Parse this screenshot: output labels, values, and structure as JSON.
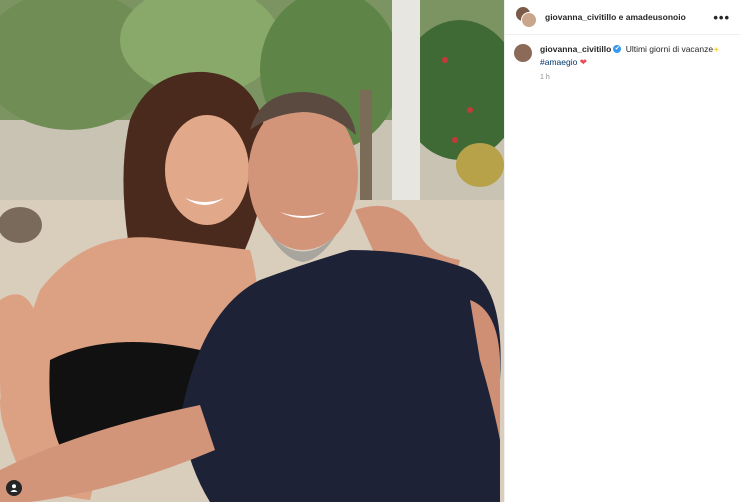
{
  "header": {
    "names": "giovanna_civitillo e amadeusonoio",
    "more_label": "•••"
  },
  "caption": {
    "username": "giovanna_civitillo",
    "verified_icon": "✔",
    "text": "Ultimi giorni di vacanze",
    "sun_emoji": "☀",
    "hashtag": "#amaegio",
    "heart_emoji": "❤",
    "time": "1 h"
  },
  "colors": {
    "verified": "#3897f0",
    "hashtag": "#00376b",
    "heart": "#ed4956",
    "time": "#8e8e8e"
  },
  "icons": {
    "tag_icon": "person-tag-icon",
    "more_icon": "more-options-icon",
    "verified_icon": "verified-badge-icon"
  }
}
